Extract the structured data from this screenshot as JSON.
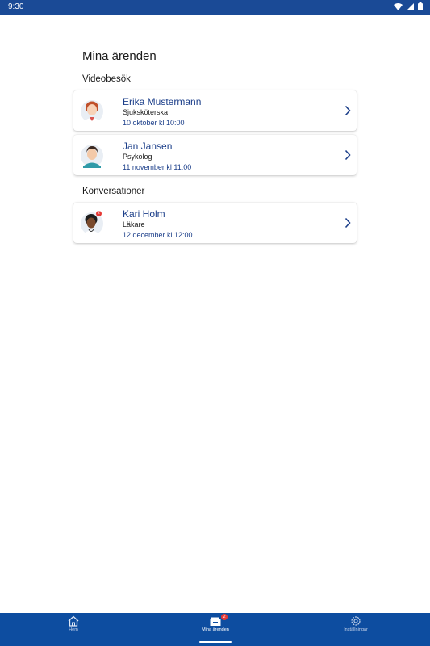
{
  "status_bar": {
    "time": "9:30"
  },
  "page": {
    "title": "Mina ärenden"
  },
  "sections": {
    "video": {
      "title": "Videobesök",
      "items": [
        {
          "name": "Erika Mustermann",
          "role": "Sjuksköterska",
          "date": "10 oktober kl 10:00"
        },
        {
          "name": "Jan Jansen",
          "role": "Psykolog",
          "date": "11 november kl 11:00"
        }
      ]
    },
    "conversations": {
      "title": "Konversationer",
      "items": [
        {
          "name": "Kari Holm",
          "role": "Läkare",
          "date": "12 december kl 12:00",
          "badge": "2"
        }
      ]
    }
  },
  "nav": {
    "home": {
      "label": "Hem",
      "icon": "home-icon"
    },
    "cases": {
      "label": "Mina ärenden",
      "icon": "inbox-icon",
      "badge": "2"
    },
    "settings": {
      "label": "Inställningar",
      "icon": "gear-icon"
    }
  },
  "colors": {
    "primary": "#0d4da0",
    "status_bar": "#1a4a96",
    "link": "#1c3f8a",
    "badge": "#e53935"
  }
}
